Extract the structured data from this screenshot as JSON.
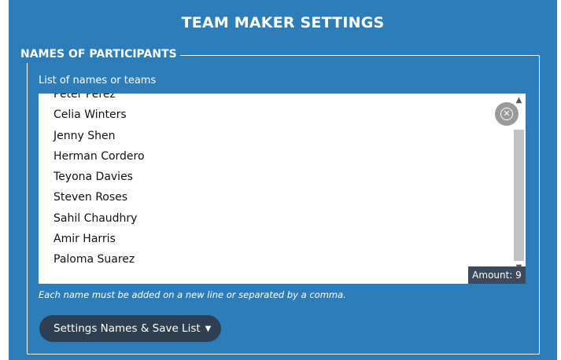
{
  "panel": {
    "title": "TEAM MAKER SETTINGS"
  },
  "fieldset": {
    "legend": "NAMES OF PARTICIPANTS",
    "list_label": "List of names or teams",
    "names": [
      "Peter Perez",
      "Celia Winters",
      "Jenny Shen",
      "Herman Cordero",
      "Teyona Davies",
      "Steven Roses",
      "Sahil Chaudhry",
      "Amir Harris",
      "Paloma Suarez"
    ],
    "amount": "Amount: 9",
    "hint": "Each name must be added on a new line or separated by a comma.",
    "settings_button": "Settings Names & Save List"
  },
  "colors": {
    "panel_bg": "#2d7dbb",
    "button_bg": "#2f3f52",
    "amount_bg": "#3b4a5c",
    "clear_btn_bg": "#9a9a9a"
  },
  "icons": {
    "clear": "close-circle-icon",
    "dropdown": "caret-down-icon"
  }
}
